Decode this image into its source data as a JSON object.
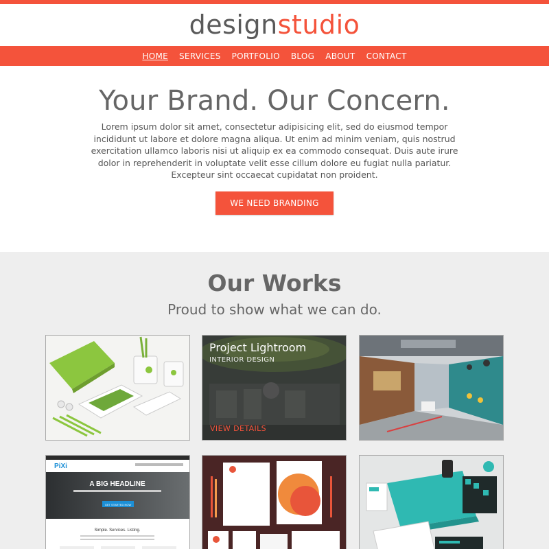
{
  "brand": {
    "part1": "design",
    "part2": "studio",
    "accent": "#f4533b"
  },
  "nav": {
    "items": [
      {
        "label": "HOME"
      },
      {
        "label": "SERVICES"
      },
      {
        "label": "PORTFOLIO"
      },
      {
        "label": "BLOG"
      },
      {
        "label": "ABOUT"
      },
      {
        "label": "CONTACT"
      }
    ]
  },
  "hero": {
    "title": "Your Brand. Our Concern.",
    "text": "Lorem ipsum dolor sit amet, consectetur adipisicing elit, sed do eiusmod tempor incididunt ut labore et dolore magna aliqua. Ut enim ad minim veniam, quis nostrud exercitation ullamco laboris nisi ut aliquip ex ea commodo consequat. Duis aute irure dolor in reprehenderit in voluptate velit esse cillum dolore eu fugiat nulla pariatur. Excepteur sint occaecat cupidatat non proident.",
    "cta": "WE NEED BRANDING"
  },
  "works": {
    "title": "Our Works",
    "subtitle": "Proud to show what we can do.",
    "featured": {
      "title": "Project Lightroom",
      "category": "INTERIOR DESIGN",
      "link": "VIEW DETAILS"
    },
    "mock_site": {
      "logo": "PiXi",
      "headline": "A BIG HEADLINE",
      "button": "GET STARTED NOW",
      "tagline": "Simple. Services. Listing."
    }
  }
}
